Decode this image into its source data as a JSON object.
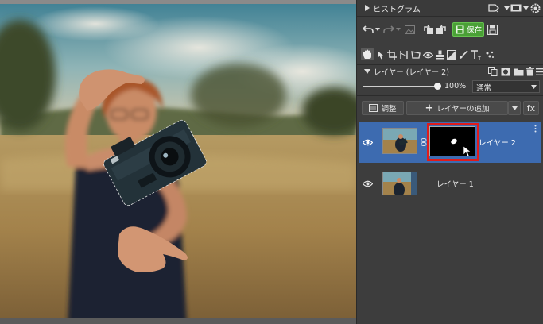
{
  "histogram": {
    "title": "ヒストグラム"
  },
  "toolbar": {
    "save_label": "保存"
  },
  "layers_header": {
    "title": "レイヤー (レイヤー 2)"
  },
  "opacity": {
    "value": 100,
    "label": "100%",
    "blend_mode": "通常"
  },
  "actions": {
    "adjust_label": "調整",
    "add_layer_label": "レイヤーの追加",
    "fx_label": "fx"
  },
  "layers": [
    {
      "name": "レイヤー 2",
      "selected": true
    },
    {
      "name": "レイヤー 1",
      "selected": false
    }
  ],
  "colors": {
    "accent": "#3d6bb0",
    "save_green": "#4aa036",
    "highlight_red": "#e01b1b",
    "panel_bg": "#3d3d3d"
  }
}
